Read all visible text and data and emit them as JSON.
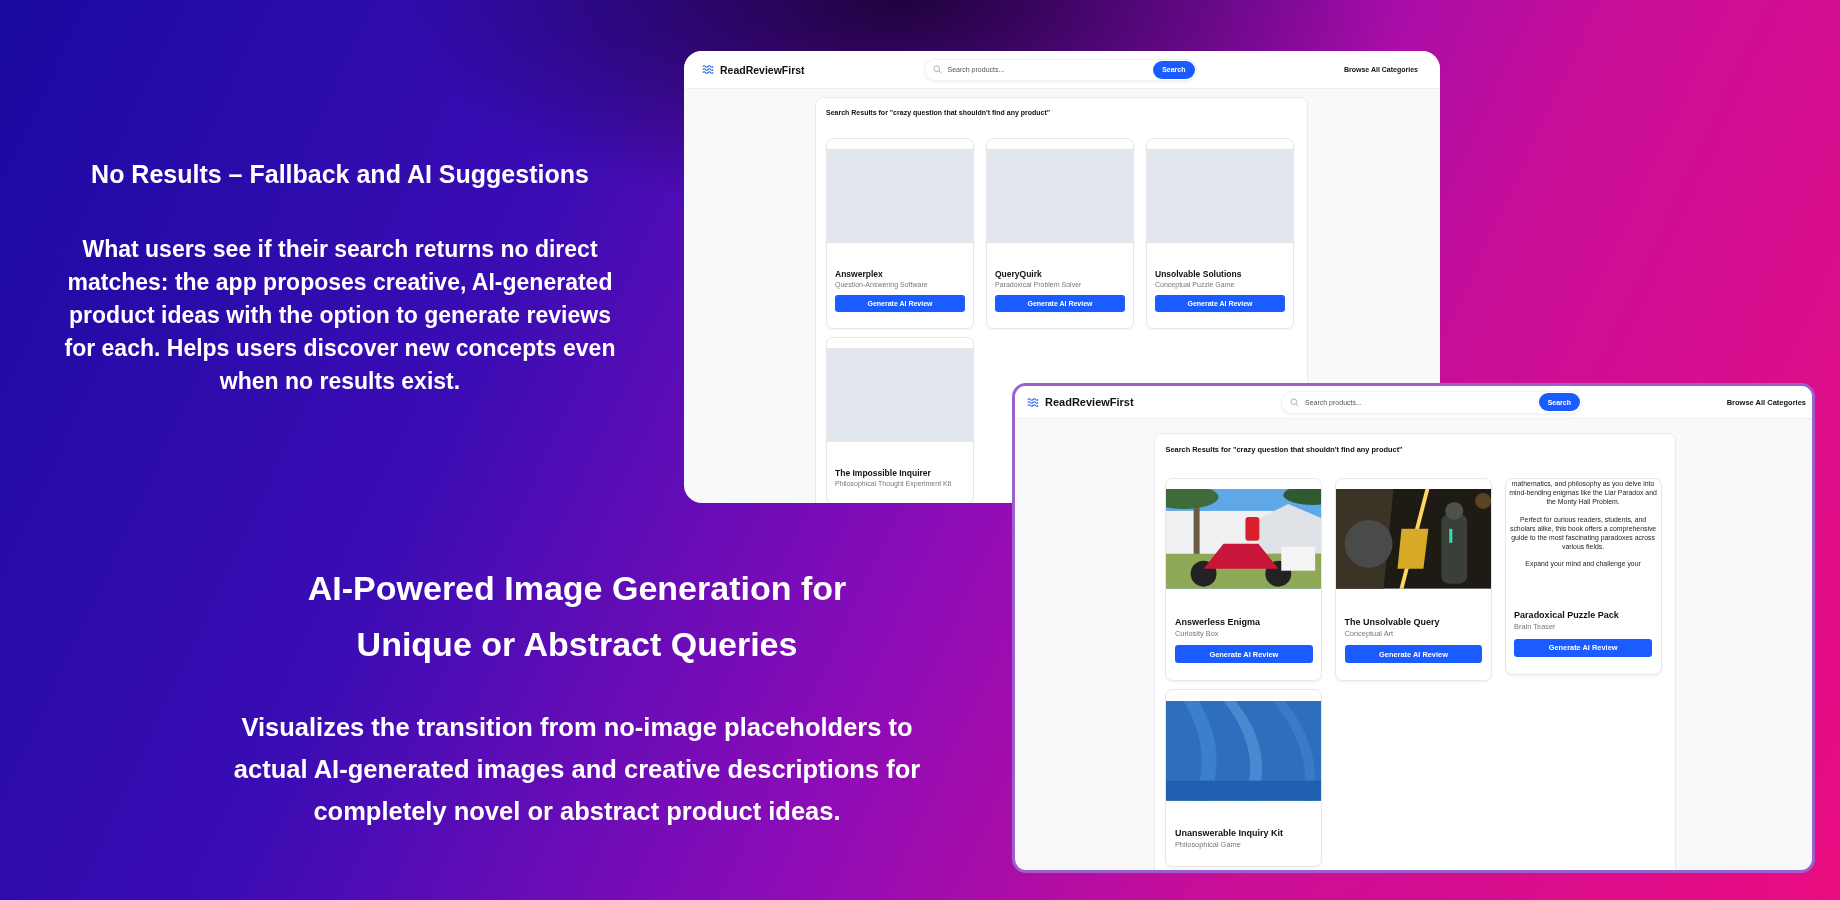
{
  "sections": [
    {
      "title": "No Results – Fallback and AI Suggestions",
      "text": "What users see if their search returns no direct matches: the app proposes creative, AI-generated product ideas with the option to generate reviews for each. Helps users discover new concepts even when no results exist."
    },
    {
      "title": "AI-Powered Image Generation for Unique or Abstract Queries",
      "text": "Visualizes the transition from no-image placeholders to actual AI-generated images and creative descriptions for completely novel or abstract product ideas."
    }
  ],
  "windows": [
    {
      "brand": "ReadReviewFirst",
      "search": {
        "placeholder": "Search products...",
        "button": "Search"
      },
      "nav_link": "Browse All Categories",
      "results_heading": "Search Results for \"crazy question that shouldn't find any product\"",
      "products": [
        {
          "kind": "placeholder",
          "name": "Answerplex",
          "category": "Question-Answering Software",
          "button": "Generate AI Review"
        },
        {
          "kind": "placeholder",
          "name": "QueryQuirk",
          "category": "Paradoxical Problem Solver",
          "button": "Generate AI Review"
        },
        {
          "kind": "placeholder",
          "name": "Unsolvable Solutions",
          "category": "Conceptual Puzzle Game",
          "button": "Generate AI Review"
        },
        {
          "kind": "placeholder",
          "name": "The Impossible Inquirer",
          "category": "Philosophical Thought Experiment Kit"
        }
      ]
    },
    {
      "brand": "ReadReviewFirst",
      "search": {
        "placeholder": "Search products...",
        "button": "Search"
      },
      "nav_link": "Browse All Categories",
      "results_heading": "Search Results for \"crazy question that shouldn't find any product\"",
      "products": [
        {
          "kind": "picture",
          "name": "Answerless Enigma",
          "category": "Curiosity Box",
          "button": "Generate AI Review"
        },
        {
          "kind": "picture",
          "name": "The Unsolvable Query",
          "category": "Conceptual Art",
          "button": "Generate AI Review"
        },
        {
          "kind": "description",
          "description": [
            "mathematics, and philosophy as you delve into mind-bending enigmas like the Liar Paradox and the Monty Hall Problem.",
            "Perfect for curious readers, students, and scholars alike, this book offers a comprehensive guide to the most fascinating paradoxes across various fields.",
            "Expand your mind and challenge your"
          ],
          "name": "Paradoxical Puzzle Pack",
          "category": "Brain Teaser",
          "button": "Generate AI Review"
        },
        {
          "kind": "picture",
          "name": "Unanswerable Inquiry Kit",
          "category": "Philosophical Game"
        }
      ]
    }
  ]
}
